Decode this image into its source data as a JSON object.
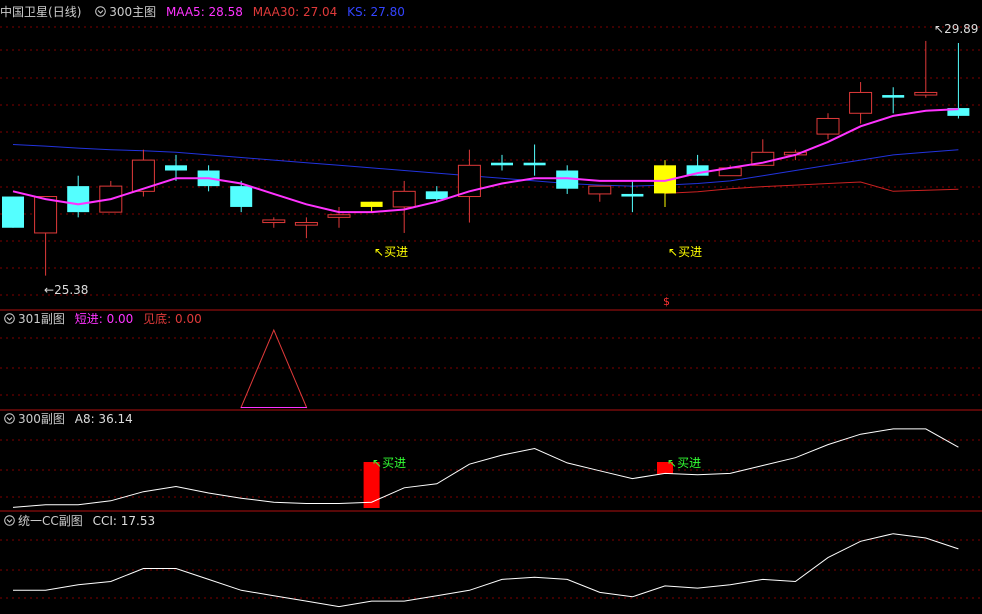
{
  "colors": {
    "background": "#000000",
    "grid": "#800000",
    "up": "#e03a3a",
    "down": "#54ffff",
    "ma5": "#ff33ff",
    "ma30": "#cc2222",
    "ks": "#2233dd",
    "signal_yellow": "#ffff00",
    "signal_green": "#33ff33",
    "signal_red": "#ff0000",
    "line_white": "#ffffff"
  },
  "main_panel": {
    "stock_name": "中国卫星",
    "period": "(日线)",
    "indicator_name": "300主图",
    "ma5_label": "MAA5: 28.58",
    "ma30_label": "MAA30: 27.04",
    "ks_label": "KS: 27.80",
    "high_marker": "29.89",
    "low_marker": "25.38",
    "buy_label": "买进",
    "dollar_marker": "$",
    "dropdown_icon": "circle-chevron-down-icon"
  },
  "sub_panel_301": {
    "title": "301副图",
    "short_label": "短进: 0.00",
    "bottom_label": "见底: 0.00"
  },
  "sub_panel_300": {
    "title": "300副图",
    "a8_label": "A8: 36.14",
    "buy_label": "买进"
  },
  "sub_panel_cci": {
    "title": "统一CC副图",
    "cci_label": "CCI: 17.53"
  },
  "chart_data": {
    "type": "candlestick",
    "y_price_range": [
      25.2,
      30.1
    ],
    "candles": [
      {
        "o": 26.9,
        "c": 26.3,
        "h": 26.9,
        "l": 26.3
      },
      {
        "o": 26.2,
        "c": 26.9,
        "h": 26.9,
        "l": 25.38
      },
      {
        "o": 27.1,
        "c": 26.6,
        "h": 27.3,
        "l": 26.5
      },
      {
        "o": 26.6,
        "c": 27.1,
        "h": 27.2,
        "l": 26.6
      },
      {
        "o": 27.0,
        "c": 27.6,
        "h": 27.8,
        "l": 26.9
      },
      {
        "o": 27.5,
        "c": 27.4,
        "h": 27.7,
        "l": 27.2
      },
      {
        "o": 27.4,
        "c": 27.1,
        "h": 27.5,
        "l": 27.0
      },
      {
        "o": 27.1,
        "c": 26.7,
        "h": 27.2,
        "l": 26.6
      },
      {
        "o": 26.4,
        "c": 26.45,
        "h": 26.5,
        "l": 26.3
      },
      {
        "o": 26.35,
        "c": 26.4,
        "h": 26.5,
        "l": 26.1
      },
      {
        "o": 26.5,
        "c": 26.55,
        "h": 26.7,
        "l": 26.3
      },
      {
        "o": 26.8,
        "c": 26.7,
        "h": 26.8,
        "l": 26.6
      },
      {
        "o": 26.7,
        "c": 27.0,
        "h": 27.2,
        "l": 26.2
      },
      {
        "o": 27.0,
        "c": 26.85,
        "h": 27.1,
        "l": 26.8
      },
      {
        "o": 26.9,
        "c": 27.5,
        "h": 27.8,
        "l": 26.4
      },
      {
        "o": 27.55,
        "c": 27.5,
        "h": 27.7,
        "l": 27.4
      },
      {
        "o": 27.55,
        "c": 27.5,
        "h": 27.9,
        "l": 27.3
      },
      {
        "o": 27.4,
        "c": 27.05,
        "h": 27.5,
        "l": 26.95
      },
      {
        "o": 26.95,
        "c": 27.1,
        "h": 27.1,
        "l": 26.8
      },
      {
        "o": 26.95,
        "c": 26.9,
        "h": 27.2,
        "l": 26.6
      },
      {
        "o": 26.96,
        "c": 27.5,
        "h": 27.6,
        "l": 26.7
      },
      {
        "o": 27.5,
        "c": 27.3,
        "h": 27.7,
        "l": 27.3
      },
      {
        "o": 27.3,
        "c": 27.45,
        "h": 27.5,
        "l": 27.3
      },
      {
        "o": 27.5,
        "c": 27.75,
        "h": 28.0,
        "l": 27.5
      },
      {
        "o": 27.7,
        "c": 27.75,
        "h": 27.8,
        "l": 27.6
      },
      {
        "o": 28.1,
        "c": 28.4,
        "h": 28.5,
        "l": 28.0
      },
      {
        "o": 28.5,
        "c": 28.9,
        "h": 29.1,
        "l": 28.3
      },
      {
        "o": 28.85,
        "c": 28.8,
        "h": 29.0,
        "l": 28.5
      },
      {
        "o": 28.85,
        "c": 28.9,
        "h": 29.89,
        "l": 28.8
      },
      {
        "o": 28.6,
        "c": 28.45,
        "h": 29.85,
        "l": 28.4
      }
    ],
    "ma5": [
      27.0,
      26.85,
      26.75,
      26.85,
      27.05,
      27.25,
      27.25,
      27.15,
      26.95,
      26.75,
      26.6,
      26.6,
      26.65,
      26.8,
      27.0,
      27.15,
      27.25,
      27.25,
      27.2,
      27.2,
      27.2,
      27.35,
      27.45,
      27.55,
      27.7,
      27.95,
      28.25,
      28.45,
      28.55,
      28.58
    ],
    "ma30": [
      null,
      null,
      null,
      null,
      null,
      null,
      null,
      null,
      null,
      null,
      null,
      null,
      null,
      null,
      null,
      null,
      null,
      null,
      null,
      null,
      26.96,
      26.99,
      27.05,
      27.09,
      27.12,
      27.15,
      27.18,
      27.0,
      27.02,
      27.04
    ],
    "ks": [
      27.9,
      27.87,
      27.83,
      27.8,
      27.78,
      27.75,
      27.7,
      27.65,
      27.6,
      27.55,
      27.5,
      27.45,
      27.4,
      27.35,
      27.3,
      27.25,
      27.2,
      27.15,
      27.12,
      27.1,
      27.12,
      27.15,
      27.2,
      27.3,
      27.4,
      27.5,
      27.6,
      27.7,
      27.75,
      27.8
    ],
    "buy_signals_main": [
      11,
      20
    ],
    "sub301_peak_index": 8,
    "a8": [
      2,
      4,
      4,
      7,
      14,
      18,
      13,
      9,
      6,
      5,
      5,
      6,
      17,
      20,
      35,
      42,
      47,
      36,
      30,
      24,
      28,
      27,
      28,
      34,
      40,
      50,
      58,
      62,
      62,
      48
    ],
    "a8_red_bars": [
      11,
      20
    ],
    "cci": [
      10,
      10,
      15,
      18,
      30,
      30,
      20,
      10,
      5,
      0,
      -5,
      0,
      0,
      5,
      10,
      20,
      22,
      20,
      8,
      4,
      14,
      12,
      15,
      20,
      18,
      40,
      55,
      62,
      58,
      48
    ]
  }
}
